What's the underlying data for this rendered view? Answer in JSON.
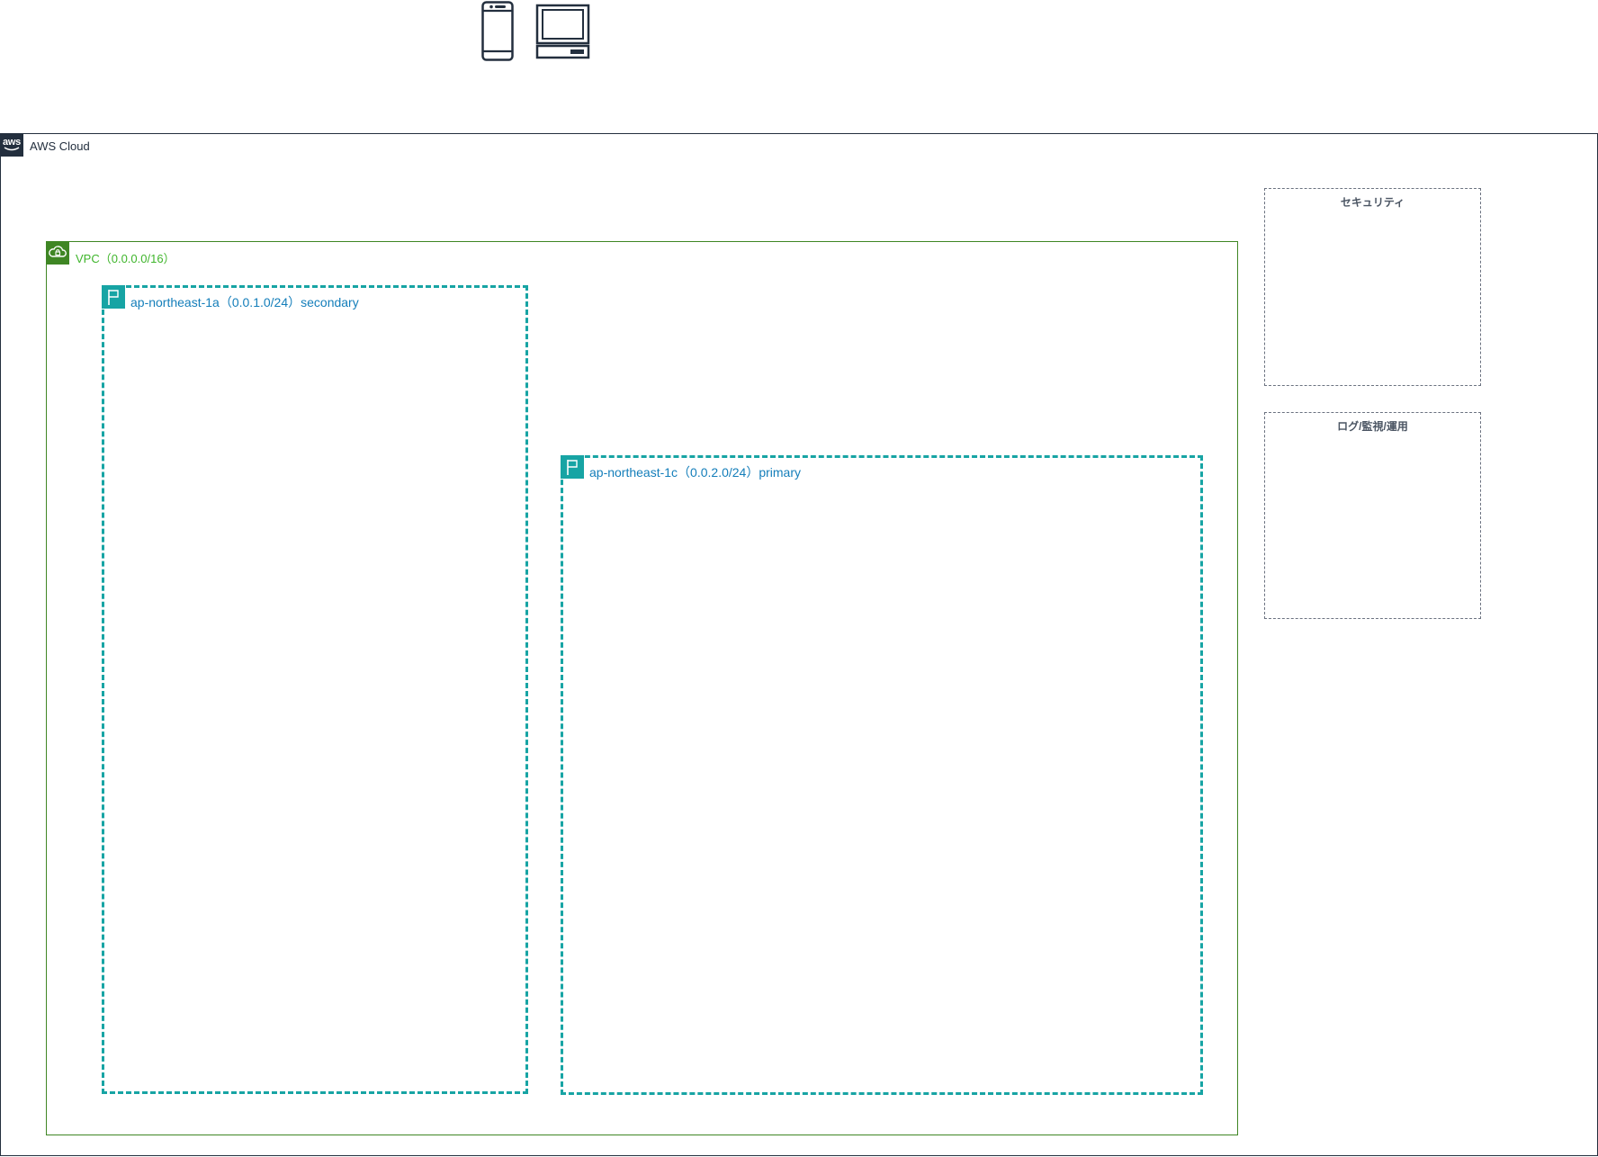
{
  "clients": [
    {
      "name": "mobile-client",
      "icon": "mobile-phone-icon"
    },
    {
      "name": "desktop-client",
      "icon": "desktop-computer-icon"
    }
  ],
  "aws_cloud": {
    "label": "AWS Cloud",
    "badge_text": "aws",
    "icon": "aws-logo-icon",
    "border_color": "#232f3e"
  },
  "vpc": {
    "label": "VPC（0.0.0.0/16）",
    "icon": "vpc-cloud-lock-icon",
    "color": "#3f8624",
    "label_color": "#3fb52b"
  },
  "availability_zones": [
    {
      "label": "ap-northeast-1a（0.0.1.0/24）secondary",
      "icon": "flag-icon",
      "color": "#17a4a4"
    },
    {
      "label": "ap-northeast-1c（0.0.2.0/24）primary",
      "icon": "flag-icon",
      "color": "#17a4a4"
    }
  ],
  "groups": {
    "security": {
      "title": "セキュリティ"
    },
    "logs": {
      "title": "ログ/監視/運用"
    }
  }
}
